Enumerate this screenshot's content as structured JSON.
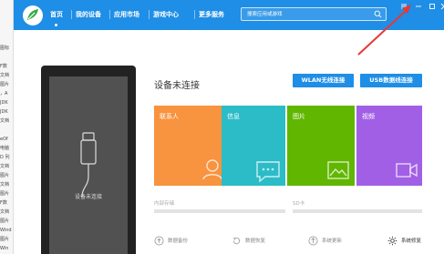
{
  "left_strip": {
    "lines": [
      "图标",
      "",
      "F数",
      "文档",
      "图片",
      "，A",
      "JDK",
      "JDK",
      "文档",
      "",
      "eOf",
      "电脑",
      "D 列",
      "文档",
      "图片",
      "文档",
      "图片",
      "F数",
      "文档",
      "图片",
      "Wind",
      "图片",
      "Win"
    ]
  },
  "nav": {
    "home": "首页",
    "my_device": "我的设备",
    "app_market": "应用市场",
    "game_center": "游戏中心",
    "more_services": "更多服务"
  },
  "search": {
    "placeholder": "搜索应用或游戏"
  },
  "phone": {
    "message": "设备未连接"
  },
  "main": {
    "status": "设备未连接",
    "wlan_button": "WLAN无线连接",
    "usb_button": "USB数据线连接"
  },
  "tiles": [
    {
      "label": "联系人",
      "color": "#f8933f"
    },
    {
      "label": "信息",
      "color": "#2cbcc8"
    },
    {
      "label": "图片",
      "color": "#61b600"
    },
    {
      "label": "视频",
      "color": "#a15fe6"
    }
  ],
  "storage": {
    "internal": "内部存储",
    "sd": "SD卡"
  },
  "actions": {
    "backup": "数据备份",
    "restore": "数据恢复",
    "update": "系统更新",
    "repair": "系统修复"
  },
  "colors": {
    "accent": "#1e8ee6",
    "annotation_arrow": "#e53935"
  }
}
